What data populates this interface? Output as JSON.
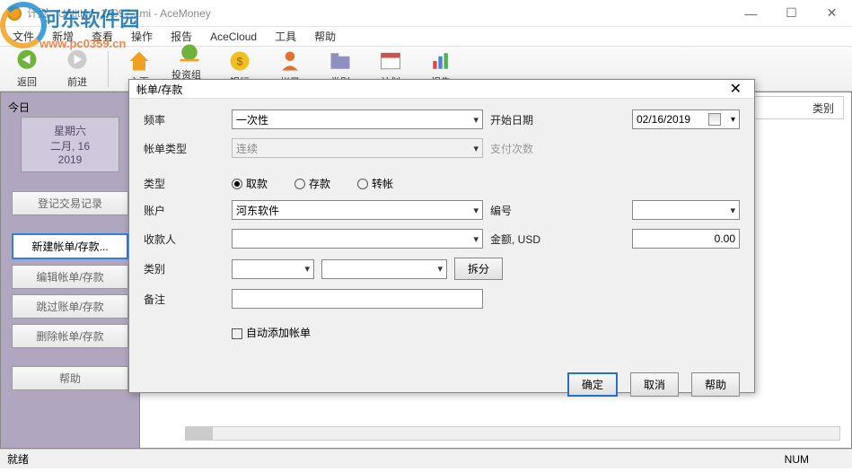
{
  "window": {
    "title": "计划 - Untitled_14097.ami - AceMoney"
  },
  "watermark": {
    "text": "河东软件园",
    "url": "www.pc0359.cn"
  },
  "menu": [
    "文件",
    "新增",
    "查看",
    "操作",
    "报告",
    "AceCloud",
    "工具",
    "帮助"
  ],
  "toolbar": {
    "back": "返回",
    "forward": "前进",
    "home": "主页",
    "portfolio": "投资组合",
    "bank": "银行",
    "accounts": "帐目",
    "category": "类别",
    "schedule": "计划",
    "report": "报告"
  },
  "left": {
    "today": "今日",
    "weekday": "星期六",
    "monthday": "二月, 16",
    "year": "2019",
    "buttons": {
      "record": "登记交易记录",
      "new": "新建帐单/存款...",
      "edit": "编辑帐单/存款",
      "skip": "跳过账单/存款",
      "delete": "删除帐单/存款",
      "help": "帮助"
    }
  },
  "content": {
    "header_col": "类别"
  },
  "dialog": {
    "title": "帐单/存款",
    "labels": {
      "frequency": "频率",
      "bill_type": "帐单类型",
      "type": "类型",
      "account": "账户",
      "payee": "收款人",
      "category": "类别",
      "memo": "备注",
      "start_date": "开始日期",
      "pay_count": "支付次数",
      "number": "编号",
      "amount": "金额, USD"
    },
    "values": {
      "frequency": "一次性",
      "bill_type": "连续",
      "account": "河东软件",
      "start_date": "02/16/2019",
      "amount": "0.00"
    },
    "radios": {
      "withdraw": "取款",
      "deposit": "存款",
      "transfer": "转帐"
    },
    "checkbox_auto": "自动添加帐单",
    "buttons": {
      "split": "拆分",
      "ok": "确定",
      "cancel": "取消",
      "help": "帮助"
    }
  },
  "statusbar": {
    "ready": "就绪",
    "num": "NUM"
  }
}
